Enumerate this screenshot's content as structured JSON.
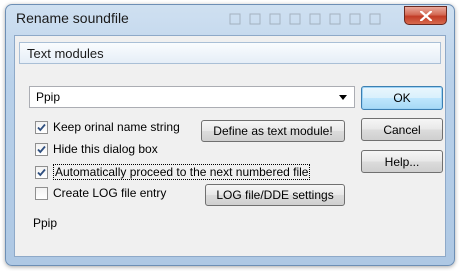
{
  "window": {
    "title": "Rename soundfile",
    "close_label": "×"
  },
  "group": {
    "title": "Text modules"
  },
  "combo": {
    "value": "Ppip"
  },
  "checkboxes": [
    {
      "label": "Keep orinal name string",
      "checked": true
    },
    {
      "label": "Hide this dialog box",
      "checked": true
    },
    {
      "label": "Automatically proceed to the next numbered file",
      "checked": true
    },
    {
      "label": "Create LOG file entry",
      "checked": false
    }
  ],
  "buttons": {
    "ok": "OK",
    "cancel": "Cancel",
    "help": "Help...",
    "define_text_module": "Define as text module!",
    "log_settings": "LOG file/DDE settings"
  },
  "status": {
    "text": "Ppip"
  },
  "icons": {
    "close": "close-icon",
    "dropdown": "chevron-down-icon",
    "check": "checkmark-icon"
  }
}
